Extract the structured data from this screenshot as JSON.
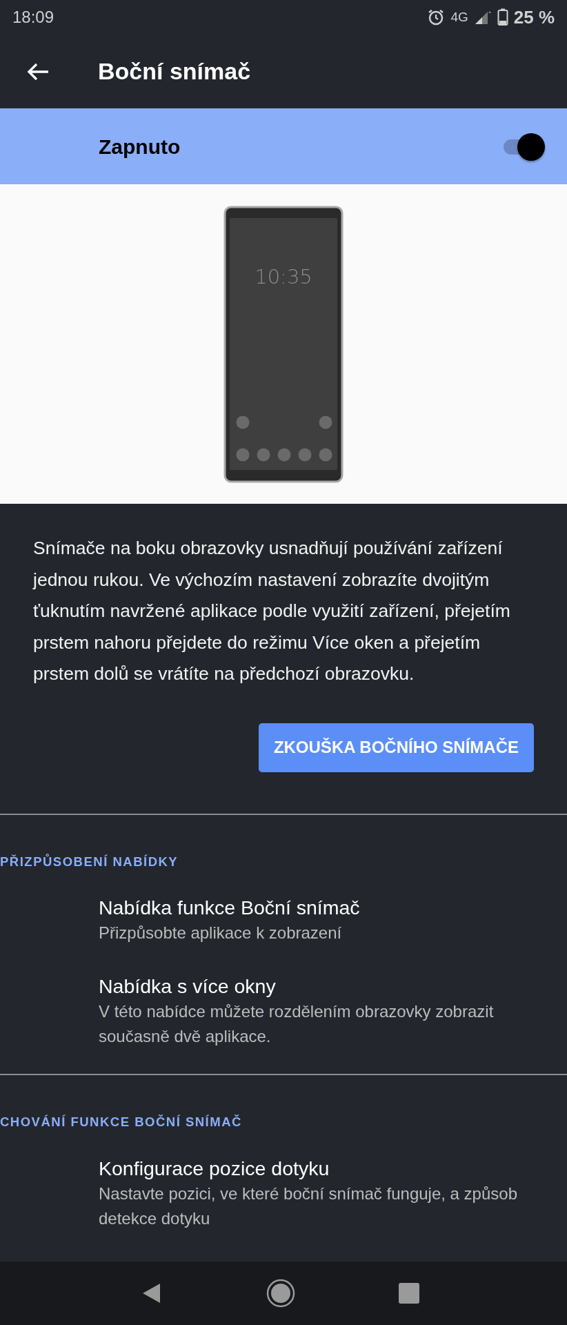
{
  "status_bar": {
    "time": "18:09",
    "network": "4G",
    "battery": "25 %"
  },
  "app_bar": {
    "title": "Boční snímač"
  },
  "master_switch": {
    "label": "Zapnuto",
    "on": true
  },
  "illustration": {
    "clock": "10:35"
  },
  "description": "Snímače na boku obrazovky usnadňují používání zařízení jednou rukou. Ve výchozím nastavení zobrazíte dvojitým ťuknutím navržené aplikace podle využití zařízení, přejetím prstem nahoru přejdete do režimu Více oken a přejetím prstem dolů se vrátíte na předchozí obrazovku.",
  "test_button": "ZKOUŠKA BOČNÍHO SNÍMAČE",
  "sections": [
    {
      "header": "PŘIZPŮSOBENÍ NABÍDKY",
      "items": [
        {
          "title": "Nabídka funkce Boční snímač",
          "summary": "Přizpůsobte aplikace k zobrazení"
        },
        {
          "title": "Nabídka s více okny",
          "summary": "V této nabídce můžete rozdělením obrazovky zobrazit současně dvě aplikace."
        }
      ]
    },
    {
      "header": "CHOVÁNÍ FUNKCE BOČNÍ SNÍMAČ",
      "items": [
        {
          "title": "Konfigurace pozice dotyku",
          "summary": "Nastavte pozici, ve které boční snímač funguje, a způsob detekce dotyku"
        }
      ]
    }
  ]
}
